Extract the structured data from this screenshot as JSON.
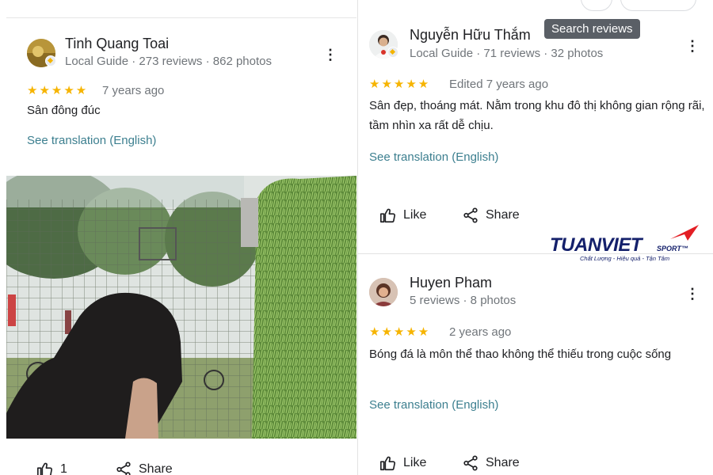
{
  "reviews": [
    {
      "name": "Tinh Quang Toai",
      "meta": "Local Guide · 273 reviews · 862 photos",
      "stars": "★★★★★",
      "time": "7 years ago",
      "text": "Sân đông đúc",
      "see_translation": "See translation (English)",
      "like_label": "1",
      "share_label": "Share"
    },
    {
      "name": "Nguyễn Hữu Thắm",
      "meta": "Local Guide · 71 reviews · 32 photos",
      "stars": "★★★★★",
      "time": "Edited 7 years ago",
      "text": "Sân đẹp, thoáng mát. Nằm trong khu đô thị không gian rộng rãi, tầm nhìn xa rất dễ chịu.",
      "see_translation": "See translation (English)",
      "like_label": "Like",
      "share_label": "Share"
    },
    {
      "name": "Huyen Pham",
      "meta": "5 reviews · 8 photos",
      "stars": "★★★★★",
      "time": "2 years ago",
      "text": "Bóng đá là môn thể thao không thể thiếu trong cuộc sống",
      "see_translation": "See translation (English)",
      "like_label": "Like",
      "share_label": "Share"
    }
  ],
  "tooltip": "Search reviews",
  "logo": {
    "main": "TUANVIET",
    "sport": "SPORT™",
    "tagline": "Chất Lượng - Hiệu quả - Tận Tâm"
  },
  "colors": {
    "star": "#f6b400",
    "link": "#3c7f8f",
    "logo": "#14206b",
    "logo_accent": "#e31e24"
  }
}
